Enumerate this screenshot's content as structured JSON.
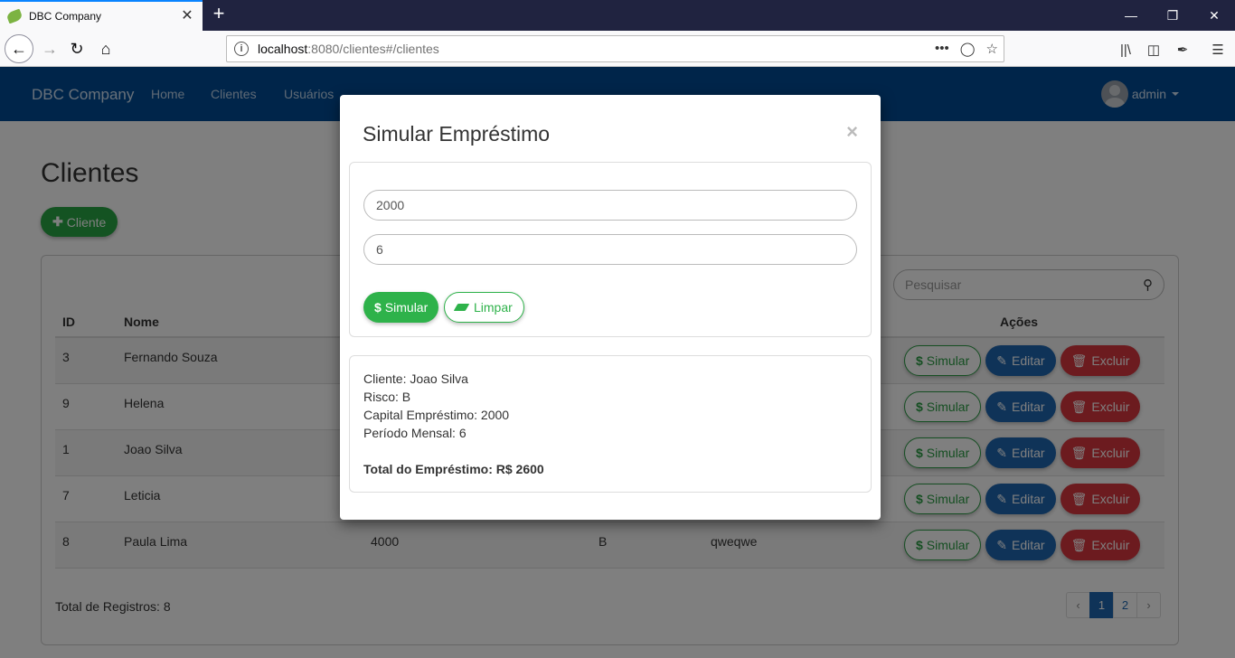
{
  "browser": {
    "tab_title": "DBC Company",
    "tab_close": "✕",
    "new_tab": "+",
    "url_host": "localhost",
    "url_rest": ":8080/clientes#/clientes"
  },
  "app": {
    "brand": "DBC Company",
    "nav": [
      "Home",
      "Clientes",
      "Usuários"
    ],
    "user": "admin"
  },
  "page": {
    "title": "Clientes",
    "add_button": "Cliente",
    "search_placeholder": "Pesquisar",
    "columns": {
      "id": "ID",
      "nome": "Nome",
      "acoes": "Ações"
    },
    "rows": [
      {
        "id": "3",
        "nome": "Fernando Souza",
        "limite": "",
        "risco": "",
        "endereco": ""
      },
      {
        "id": "9",
        "nome": "Helena",
        "limite": "",
        "risco": "",
        "endereco": ""
      },
      {
        "id": "1",
        "nome": "Joao Silva",
        "limite": "",
        "risco": "",
        "endereco": ""
      },
      {
        "id": "7",
        "nome": "Leticia",
        "limite": "",
        "risco": "",
        "endereco": ""
      },
      {
        "id": "8",
        "nome": "Paula Lima",
        "limite": "4000",
        "risco": "B",
        "endereco": "qweqwe"
      }
    ],
    "row_actions": {
      "simular": "Simular",
      "editar": "Editar",
      "excluir": "Excluir"
    },
    "total_registros": "Total de Registros: 8",
    "pagination": {
      "prev": "‹",
      "pages": [
        "1",
        "2"
      ],
      "next": "›",
      "active": "1"
    }
  },
  "modal": {
    "title": "Simular Empréstimo",
    "close": "×",
    "capital_value": "2000",
    "periodo_value": "6",
    "simular_label": "Simular",
    "limpar_label": "Limpar",
    "result": {
      "cliente": "Cliente: Joao Silva",
      "risco": "Risco: B",
      "capital": "Capital Empréstimo: 2000",
      "periodo": "Período Mensal: 6",
      "total": "Total do Empréstimo: R$ 2600"
    }
  },
  "colors": {
    "navbar": "#004b94",
    "success": "#28a745",
    "primary": "#1f67b1",
    "danger": "#d9363e"
  }
}
